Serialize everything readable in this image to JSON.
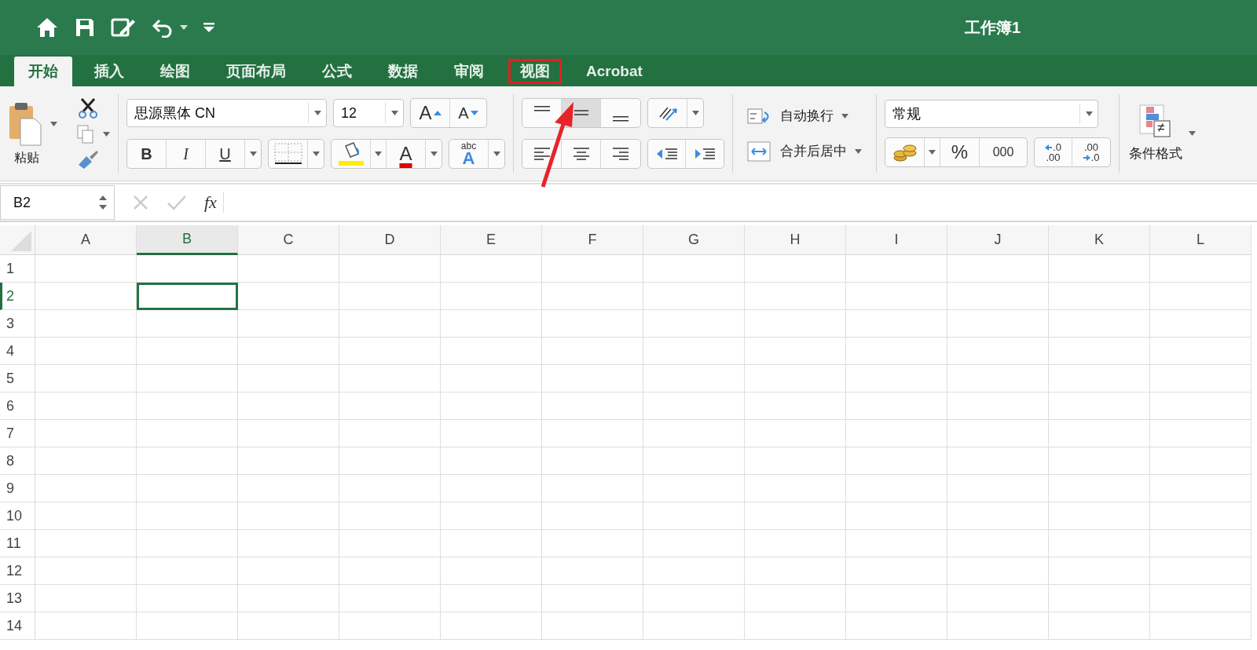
{
  "window": {
    "title": "工作簿1"
  },
  "tabs": [
    {
      "label": "开始",
      "selected": true,
      "highlighted": false
    },
    {
      "label": "插入",
      "selected": false,
      "highlighted": false
    },
    {
      "label": "绘图",
      "selected": false,
      "highlighted": false
    },
    {
      "label": "页面布局",
      "selected": false,
      "highlighted": false
    },
    {
      "label": "公式",
      "selected": false,
      "highlighted": false
    },
    {
      "label": "数据",
      "selected": false,
      "highlighted": false
    },
    {
      "label": "审阅",
      "selected": false,
      "highlighted": false
    },
    {
      "label": "视图",
      "selected": false,
      "highlighted": true
    },
    {
      "label": "Acrobat",
      "selected": false,
      "highlighted": false
    }
  ],
  "ribbon": {
    "paste_label": "粘贴",
    "font": "思源黑体 CN",
    "size": "12",
    "grow": "A",
    "shrink": "A",
    "styles": [
      {
        "label": "B",
        "kind": "bold"
      },
      {
        "label": "I",
        "kind": "italic"
      },
      {
        "label": "U",
        "kind": "underline"
      }
    ],
    "font_color": "A",
    "orientation_label": "abc",
    "orientation_letter": "A",
    "wrap_text": "自动换行",
    "merge": "合并后居中",
    "number_format": "常规",
    "percent": "%",
    "thousands": "000",
    "increase_decimal": [
      ".0",
      ".00"
    ],
    "decrease_decimal": [
      ".00",
      ".0"
    ],
    "conditional_format": "条件格式",
    "not_equal": "≠"
  },
  "formula_bar": {
    "name_box": "B2",
    "fx": "fx"
  },
  "columns": [
    {
      "label": "A",
      "selected": false
    },
    {
      "label": "B",
      "selected": true
    },
    {
      "label": "C",
      "selected": false
    },
    {
      "label": "D",
      "selected": false
    },
    {
      "label": "E",
      "selected": false
    },
    {
      "label": "F",
      "selected": false
    },
    {
      "label": "G",
      "selected": false
    },
    {
      "label": "H",
      "selected": false
    },
    {
      "label": "I",
      "selected": false
    },
    {
      "label": "J",
      "selected": false
    },
    {
      "label": "K",
      "selected": false
    },
    {
      "label": "L",
      "selected": false
    }
  ],
  "rows": [
    {
      "label": "1",
      "selected": false
    },
    {
      "label": "2",
      "selected": true
    },
    {
      "label": "3",
      "selected": false
    },
    {
      "label": "4",
      "selected": false
    },
    {
      "label": "5",
      "selected": false
    },
    {
      "label": "6",
      "selected": false
    },
    {
      "label": "7",
      "selected": false
    },
    {
      "label": "8",
      "selected": false
    },
    {
      "label": "9",
      "selected": false
    },
    {
      "label": "10",
      "selected": false
    },
    {
      "label": "11",
      "selected": false
    },
    {
      "label": "12",
      "selected": false
    },
    {
      "label": "13",
      "selected": false
    },
    {
      "label": "14",
      "selected": false
    }
  ]
}
